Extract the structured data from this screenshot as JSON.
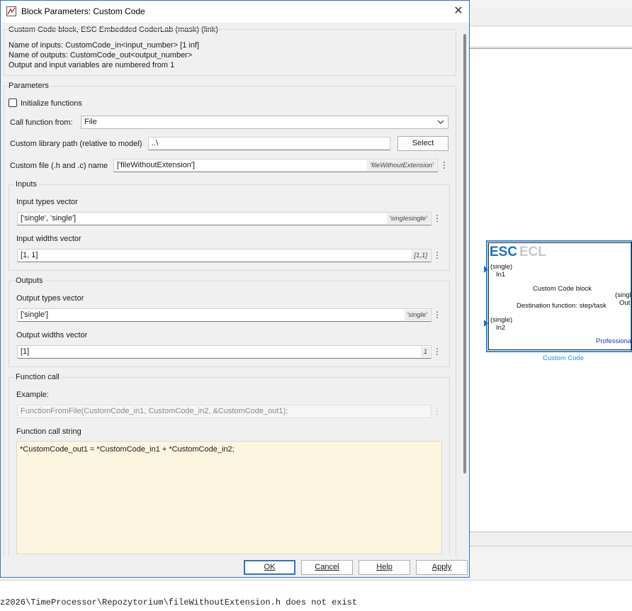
{
  "dialog": {
    "title": "Block Parameters: Custom Code",
    "header": "Custom Code block, ESC Embedded CoderLab  (mask) (link)",
    "description": [
      "Name of inputs: CustomCode_in<input_number> [1 inf]",
      "Name of outputs: CustomCode_out<output_number>",
      "Output and input variables are numbered from 1"
    ],
    "parameters_label": "Parameters",
    "init_functions_label": "Initialize functions",
    "init_functions_checked": false,
    "call_from_label": "Call function from:",
    "call_from_value": "File",
    "library_path_label": "Custom library path (relative to model)",
    "library_path_value": "..\\",
    "select_button": "Select",
    "custom_file_label": "Custom file (.h and .c) name",
    "custom_file_value": "['fileWithoutExtension']",
    "custom_file_hint": "'fileWithoutExtension'",
    "inputs": {
      "group_label": "Inputs",
      "types_label": "Input types vector",
      "types_value": "['single', 'single']",
      "types_hint": "'singlesingle'",
      "widths_label": "Input widths vector",
      "widths_value": "[1, 1]",
      "widths_hint": "[1,1]"
    },
    "outputs": {
      "group_label": "Outputs",
      "types_label": "Output types vector",
      "types_value": "['single']",
      "types_hint": "'single'",
      "widths_label": "Output widths vector",
      "widths_value": "[1]",
      "widths_hint": "1"
    },
    "function_call": {
      "group_label": "Function call",
      "example_label": "Example:",
      "example_value": "FunctionFromFile(CustomCode_in1, CustomCode_in2, &CustomCode_out1);",
      "string_label": "Function call string",
      "string_value": "*CustomCode_out1 = *CustomCode_in1 + *CustomCode_in2;"
    },
    "buttons": {
      "ok": "OK",
      "cancel": "Cancel",
      "help": "Help",
      "apply": "Apply"
    }
  },
  "block": {
    "brand_esc": "ESC",
    "brand_ecl": "ECL",
    "in1_type": "(single)",
    "in1_name": "In1",
    "in2_type": "(single)",
    "in2_name": "In2",
    "title": "Custom Code block",
    "destination": "Destination function: step/task",
    "out_type": "(singl",
    "out_name": "Out",
    "professional": "Professiona",
    "caption": "Custom Code"
  },
  "console": {
    "message": "z2026\\TimeProcessor\\Repozytorium\\fileWithoutExtension.h does not exist"
  },
  "colors": {
    "accent": "#2b78c5",
    "brand_blue": "#1b6fc4",
    "call_string_bg": "#fdf5df"
  }
}
